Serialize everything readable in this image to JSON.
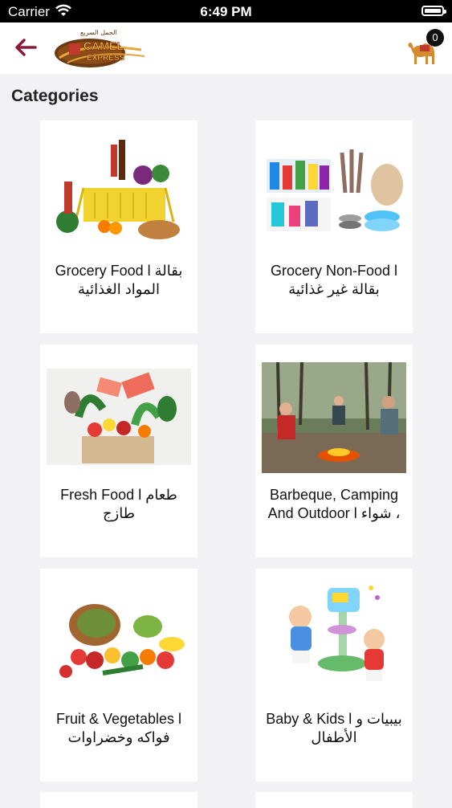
{
  "status_bar": {
    "carrier": "Carrier",
    "time": "6:49 PM"
  },
  "navbar": {
    "logo_text_top": "الجمل السريع",
    "logo_text_main": "CAMEL",
    "logo_text_sub": "EXPRESS",
    "cart_count": "0"
  },
  "page": {
    "title": "Categories"
  },
  "categories": [
    {
      "label": "Grocery Food l بقالة المواد الغذائية"
    },
    {
      "label": "Grocery Non-Food l بقالة غير غذائية"
    },
    {
      "label": "Fresh Food l طعام طازج"
    },
    {
      "label": "Barbeque, Camping And Outdoor l شواء ،"
    },
    {
      "label": "Fruit & Vegetables l فواكه وخضراوات"
    },
    {
      "label": "Baby & Kids l بيبيات و الأطفال"
    }
  ],
  "colors": {
    "accent": "#8b1a3a",
    "card_bg": "#ffffff",
    "page_bg": "#f2f2f4"
  }
}
